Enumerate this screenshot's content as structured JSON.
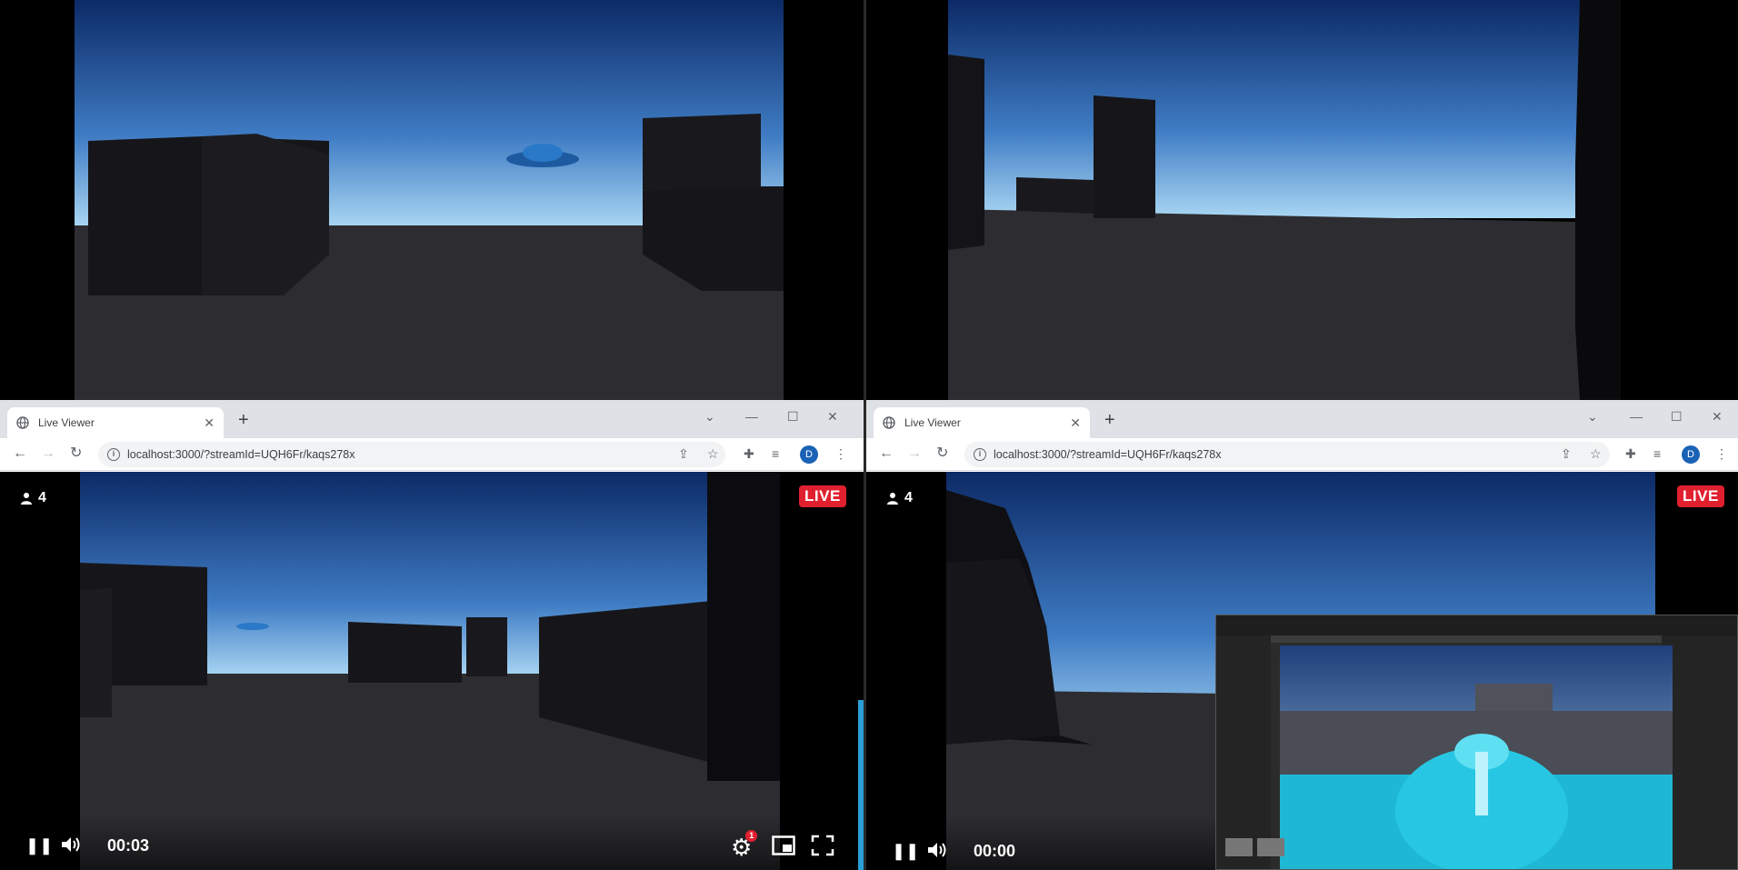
{
  "windows": [
    {
      "tab_title": "Live Viewer",
      "url": "localhost:3000/?streamId=UQH6Fr/kaqs278x",
      "viewer_count": "4",
      "live_label": "LIVE",
      "time": "00:03",
      "settings_badge": "1",
      "profile_initial": "D"
    },
    {
      "tab_title": "Live Viewer",
      "url": "localhost:3000/?streamId=UQH6Fr/kaqs278x",
      "viewer_count": "4",
      "live_label": "LIVE",
      "time": "00:00",
      "profile_initial": "D"
    }
  ],
  "icons": {
    "favicon": "globe-icon",
    "close": "close-icon",
    "new_tab": "plus-icon",
    "back": "arrow-left-icon",
    "forward": "arrow-right-icon",
    "reload": "reload-icon",
    "share": "share-icon",
    "bookmark": "star-icon",
    "extensions": "puzzle-icon",
    "reading_list": "reading-list-icon",
    "menu": "kebab-menu-icon",
    "pause": "pause-icon",
    "volume": "volume-icon",
    "settings": "gear-icon",
    "pip": "picture-in-picture-icon",
    "fullscreen": "fullscreen-icon",
    "viewers": "person-icon"
  },
  "colors": {
    "live_badge": "#e0202f",
    "tab_strip": "#dee1e6",
    "profile": "#1a62b5",
    "progress": "#2a9fd6"
  }
}
